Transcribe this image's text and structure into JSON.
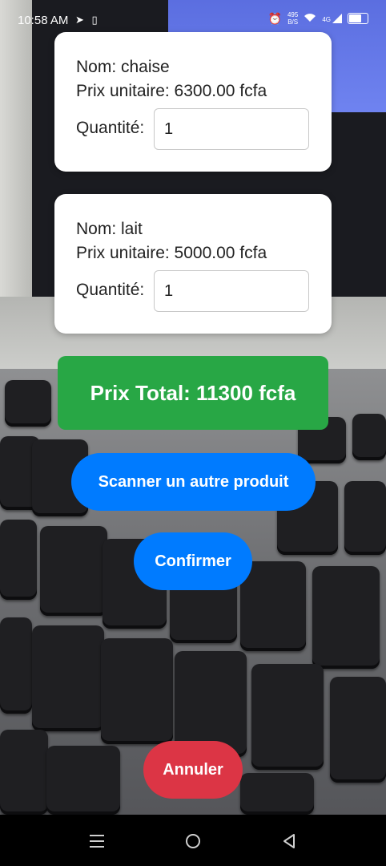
{
  "status_bar": {
    "time": "10:58 AM",
    "left_icons": [
      "telegram-icon",
      "sim-card-icon"
    ],
    "right_icons": [
      "alarm-icon",
      "network-speed-icon",
      "wifi-icon",
      "signal-4g-icon",
      "battery-icon"
    ],
    "speed_top": "495",
    "speed_unit": "B/S",
    "net_type": "4G",
    "battery_level": "59"
  },
  "products": [
    {
      "name_line": "Nom: chaise",
      "price_line": "Prix unitaire: 6300.00 fcfa",
      "qty_label": "Quantité:",
      "qty_value": "1"
    },
    {
      "name_line": "Nom: lait",
      "price_line": "Prix unitaire: 5000.00 fcfa",
      "qty_label": "Quantité:",
      "qty_value": "1"
    }
  ],
  "total": {
    "label": "Prix Total: 11300 fcfa"
  },
  "buttons": {
    "scan": "Scanner un autre produit",
    "confirm": "Confirmer",
    "cancel": "Annuler"
  },
  "nav": [
    "menu-icon",
    "home-icon",
    "back-icon"
  ],
  "colors": {
    "total_bg": "#28a745",
    "primary_button": "#007bff",
    "cancel_button": "#dc3545",
    "card_bg": "#ffffff"
  }
}
